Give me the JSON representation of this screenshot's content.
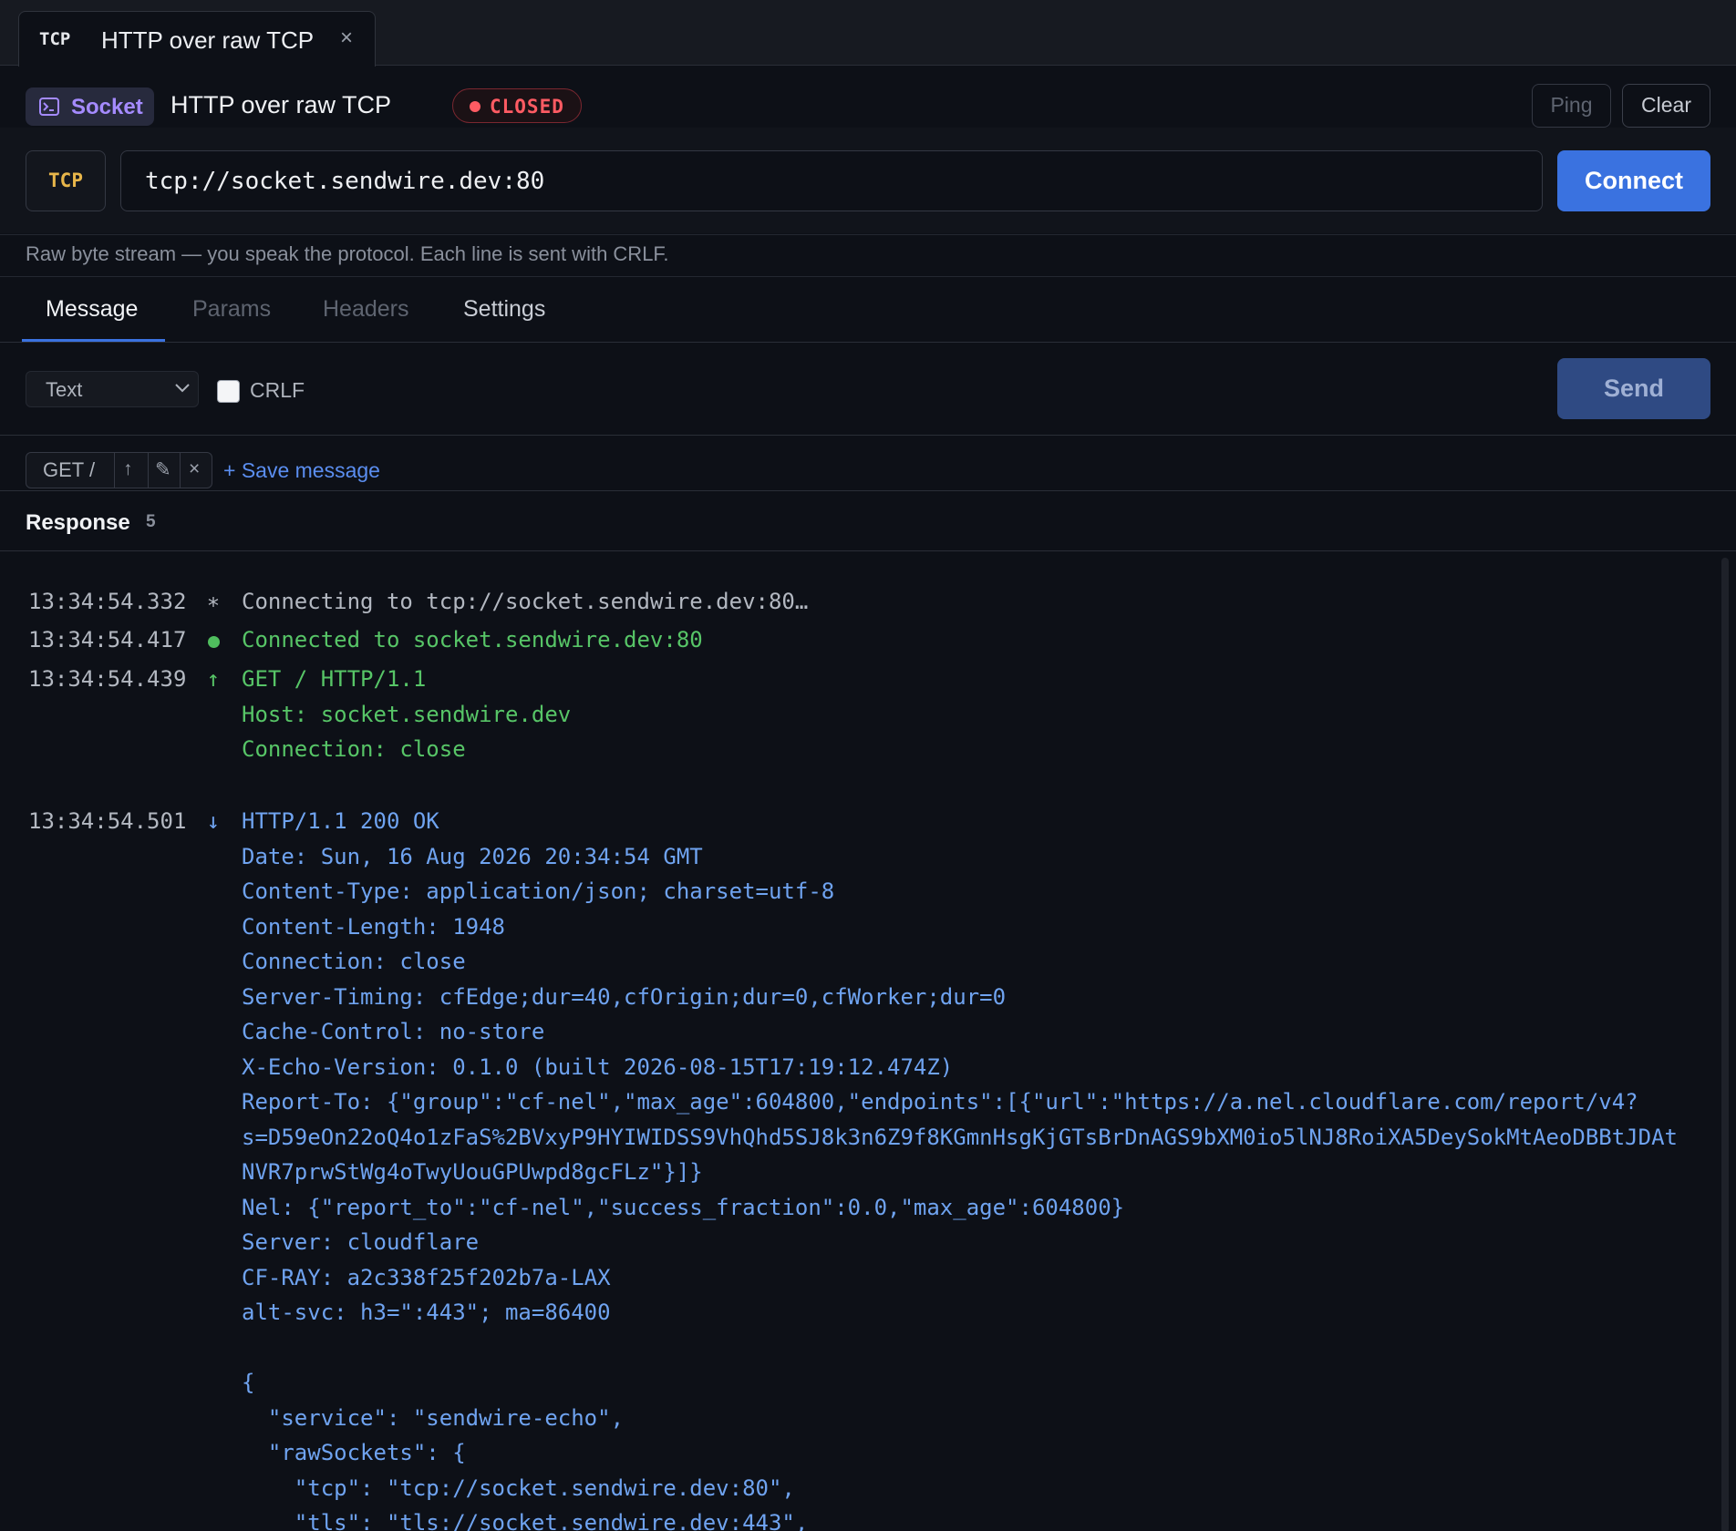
{
  "tab": {
    "protocol": "TCP",
    "title": "HTTP over raw TCP",
    "close": "×"
  },
  "header": {
    "badge_label": "Socket",
    "title": "HTTP over raw TCP",
    "status": "CLOSED",
    "status_color": "#ff5b63",
    "ping_label": "Ping",
    "clear_label": "Clear"
  },
  "url_bar": {
    "protocol": "TCP",
    "url": "tcp://socket.sendwire.dev:80",
    "connect_label": "Connect",
    "accent": "#3a72e0"
  },
  "hint": "Raw byte stream — you speak the protocol. Each line is sent with CRLF.",
  "tabs": [
    {
      "label": "Message",
      "active": true
    },
    {
      "label": "Params",
      "active": false
    },
    {
      "label": "Headers",
      "active": false
    },
    {
      "label": "Settings",
      "active": false
    }
  ],
  "message": {
    "format": "Text",
    "crlf_label": "CRLF",
    "crlf_checked": false,
    "send_label": "Send"
  },
  "saved": {
    "name": "GET /",
    "up_icon": "↑",
    "edit_icon": "✎",
    "delete_icon": "×",
    "save_label": "+ Save message"
  },
  "response": {
    "title": "Response",
    "count": "5",
    "entries": [
      {
        "time": "13:34:54.332",
        "icon": "∗",
        "kind": "info",
        "lines": [
          "Connecting to tcp://socket.sendwire.dev:80…"
        ]
      },
      {
        "time": "13:34:54.417",
        "icon": "●",
        "kind": "connected",
        "lines": [
          "Connected to socket.sendwire.dev:80"
        ]
      },
      {
        "time": "13:34:54.439",
        "icon": "↑",
        "kind": "sent",
        "lines": [
          "GET / HTTP/1.1",
          "Host: socket.sendwire.dev",
          "Connection: close"
        ]
      },
      {
        "time": "13:34:54.501",
        "icon": "↓",
        "kind": "received",
        "lines": [
          "HTTP/1.1 200 OK",
          "Date: Sun, 16 Aug 2026 20:34:54 GMT",
          "Content-Type: application/json; charset=utf-8",
          "Content-Length: 1948",
          "Connection: close",
          "Server-Timing: cfEdge;dur=40,cfOrigin;dur=0,cfWorker;dur=0",
          "Cache-Control: no-store",
          "X-Echo-Version: 0.1.0 (built 2026-08-15T17:19:12.474Z)",
          "Report-To: {\"group\":\"cf-nel\",\"max_age\":604800,\"endpoints\":[{\"url\":\"https://a.nel.cloudflare.com/report/v4?",
          "s=D59eOn22oQ4o1zFaS%2BVxyP9HYIWIDSS9VhQhd5SJ8k3n6Z9f8KGmnHsgKjGTsBrDnAGS9bXM0io5lNJ8RoiXA5DeySokMtAeoDBBtJDAt",
          "NVR7prwStWg4oTwyUouGPUwpd8gcFLz\"}]}",
          "Nel: {\"report_to\":\"cf-nel\",\"success_fraction\":0.0,\"max_age\":604800}",
          "Server: cloudflare",
          "CF-RAY: a2c338f25f202b7a-LAX",
          "alt-svc: h3=\":443\"; ma=86400",
          "",
          "{",
          "  \"service\": \"sendwire-echo\",",
          "  \"rawSockets\": {",
          "    \"tcp\": \"tcp://socket.sendwire.dev:80\",",
          "    \"tls\": \"tls://socket.sendwire.dev:443\","
        ]
      }
    ]
  }
}
